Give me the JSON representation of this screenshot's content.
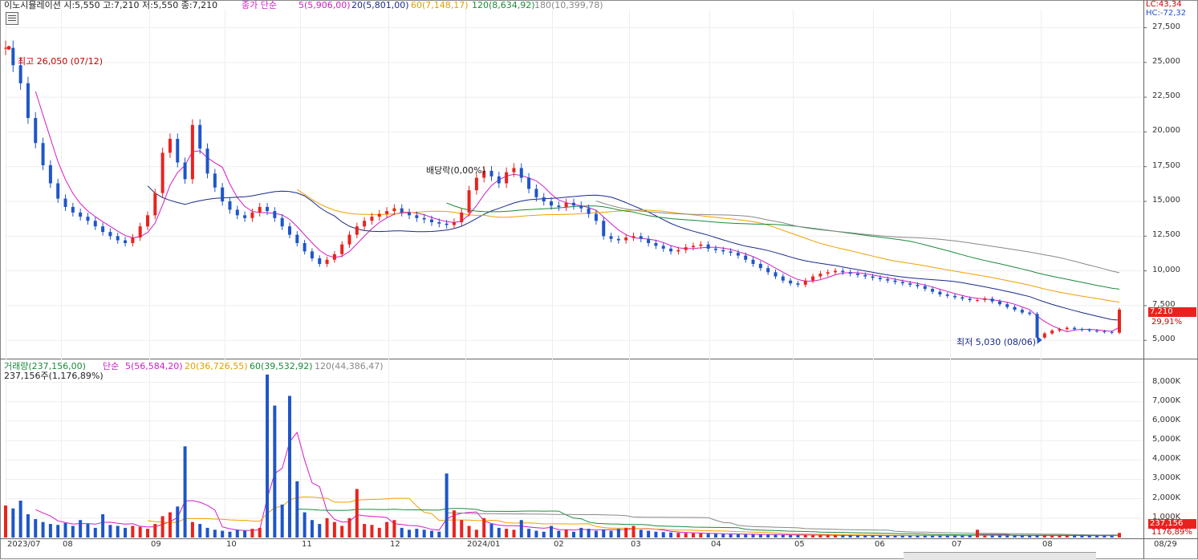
{
  "header": {
    "stock_info": "이노시뮬레이션 시:5,550 고:7,210 저:5,550 종:7,210",
    "ma_title": "종가 단순",
    "ma5": "5(5,906,00)",
    "ma20": "20(5,801,00)",
    "ma60": "60(7,148,17)",
    "ma120": "120(8,634,92)",
    "ma180": "180(10,399,78)"
  },
  "top_right": {
    "lc": "LC:43,34",
    "hc": "HC:-72,32"
  },
  "annotations": {
    "high": "최고 26,050 (07/12)",
    "low": "최저 5,030 (08/06)",
    "dividend": "배당락(0,00%)"
  },
  "price_tag": {
    "value": "7,210",
    "pct": "29,91%"
  },
  "volume_header": {
    "title": "거래량(237,156,00)",
    "ma_title": "단순",
    "ma5": "5(56,584,20)",
    "ma20": "20(36,726,55)",
    "ma60": "60(39,532,92)",
    "ma120": "120(44,386,47)",
    "sub": "237,156주(1,176,89%)"
  },
  "volume_tag": {
    "value": "237,156",
    "pct": "1176,89%"
  },
  "price_axis": [
    "27,500",
    "25,000",
    "22,500",
    "20,000",
    "17,500",
    "15,000",
    "12,500",
    "10,000",
    "7,500",
    "5,000"
  ],
  "volume_axis": [
    "8,000K",
    "7,000K",
    "6,000K",
    "5,000K",
    "4,000K",
    "3,000K",
    "2,000K",
    "1,000K"
  ],
  "x_axis": [
    "2023/07",
    "08",
    "09",
    "10",
    "11",
    "12",
    "2024/01",
    "02",
    "03",
    "04",
    "05",
    "06",
    "07",
    "08",
    "08/29"
  ],
  "colors": {
    "up": "#e8231f",
    "down": "#1f55c8",
    "ma5": "#d01ec8",
    "ma20": "#1a2a8a",
    "ma60": "#f0a000",
    "ma120": "#1a8a3a",
    "ma180": "#888888"
  },
  "chart_data": {
    "type": "candlestick",
    "title": "이노시뮬레이션",
    "last": {
      "open": 5550,
      "high": 7210,
      "low": 5550,
      "close": 7210
    },
    "high_point": {
      "value": 26050,
      "date": "07/12"
    },
    "low_point": {
      "value": 5030,
      "date": "08/06"
    },
    "price_ylim": [
      3800,
      28800
    ],
    "volume_ylim": [
      0,
      8600000
    ],
    "months": [
      "2023/07",
      "08",
      "09",
      "10",
      "11",
      "12",
      "2024/01",
      "02",
      "03",
      "04",
      "05",
      "06",
      "07",
      "08"
    ],
    "close_series": [
      26050,
      24800,
      23500,
      21000,
      19200,
      17600,
      16300,
      15200,
      14600,
      14200,
      13900,
      13600,
      13200,
      12800,
      12500,
      12200,
      12000,
      12400,
      13200,
      14000,
      15600,
      18500,
      19500,
      17800,
      16600,
      20500,
      18800,
      17000,
      16000,
      15000,
      14400,
      14000,
      13800,
      14200,
      14600,
      14300,
      13800,
      13200,
      12600,
      12000,
      11400,
      10900,
      10500,
      10800,
      11200,
      11900,
      12600,
      13200,
      13600,
      13900,
      14100,
      14300,
      14500,
      14200,
      14000,
      13800,
      13700,
      13500,
      13400,
      13300,
      13500,
      14200,
      15800,
      16700,
      17200,
      16800,
      16300,
      17100,
      17400,
      16700,
      15900,
      15300,
      15000,
      14700,
      14600,
      14900,
      14700,
      14500,
      14100,
      13600,
      12500,
      12300,
      12200,
      12400,
      12500,
      12300,
      12000,
      11800,
      11600,
      11400,
      11500,
      11700,
      11800,
      11900,
      11600,
      11500,
      11400,
      11300,
      11100,
      10800,
      10500,
      10200,
      9900,
      9600,
      9300,
      9100,
      9000,
      9300,
      9600,
      9800,
      9900,
      10000,
      9900,
      9800,
      9700,
      9600,
      9500,
      9400,
      9300,
      9200,
      9100,
      9000,
      8900,
      8700,
      8500,
      8300,
      8200,
      8100,
      8000,
      7900,
      7900,
      8000,
      7800,
      7600,
      7400,
      7200,
      7000,
      6900,
      5200,
      5500,
      5700,
      5800,
      5900,
      5800,
      5750,
      5700,
      5650,
      5600,
      5550,
      7210
    ],
    "volume_series": [
      1650,
      1500,
      1900,
      1200,
      950,
      800,
      700,
      650,
      750,
      600,
      900,
      700,
      500,
      1200,
      650,
      600,
      500,
      600,
      550,
      450,
      700,
      1100,
      1300,
      1600,
      4700,
      800,
      700,
      500,
      400,
      350,
      300,
      400,
      350,
      450,
      500,
      8400,
      6800,
      1700,
      7300,
      2900,
      1300,
      900,
      700,
      1000,
      800,
      600,
      1000,
      2500,
      700,
      650,
      500,
      800,
      900,
      500,
      400,
      450,
      400,
      350,
      300,
      3300,
      1400,
      900,
      600,
      400,
      1000,
      700,
      500,
      450,
      400,
      900,
      450,
      350,
      300,
      600,
      350,
      400,
      300,
      500,
      450,
      350,
      400,
      350,
      450,
      500,
      600,
      400,
      350,
      300,
      280,
      260,
      240,
      230,
      220,
      210,
      200,
      190,
      180,
      170,
      170,
      160,
      160,
      150,
      150,
      140,
      140,
      130,
      130,
      130,
      120,
      120,
      120,
      110,
      110,
      110,
      100,
      100,
      100,
      100,
      100,
      100,
      100,
      100,
      100,
      100,
      100,
      100,
      100,
      100,
      100,
      100,
      400,
      100,
      100,
      100,
      100,
      100,
      100,
      100,
      120,
      110,
      100,
      100,
      100,
      100,
      100,
      100,
      100,
      100,
      100,
      237
    ]
  }
}
